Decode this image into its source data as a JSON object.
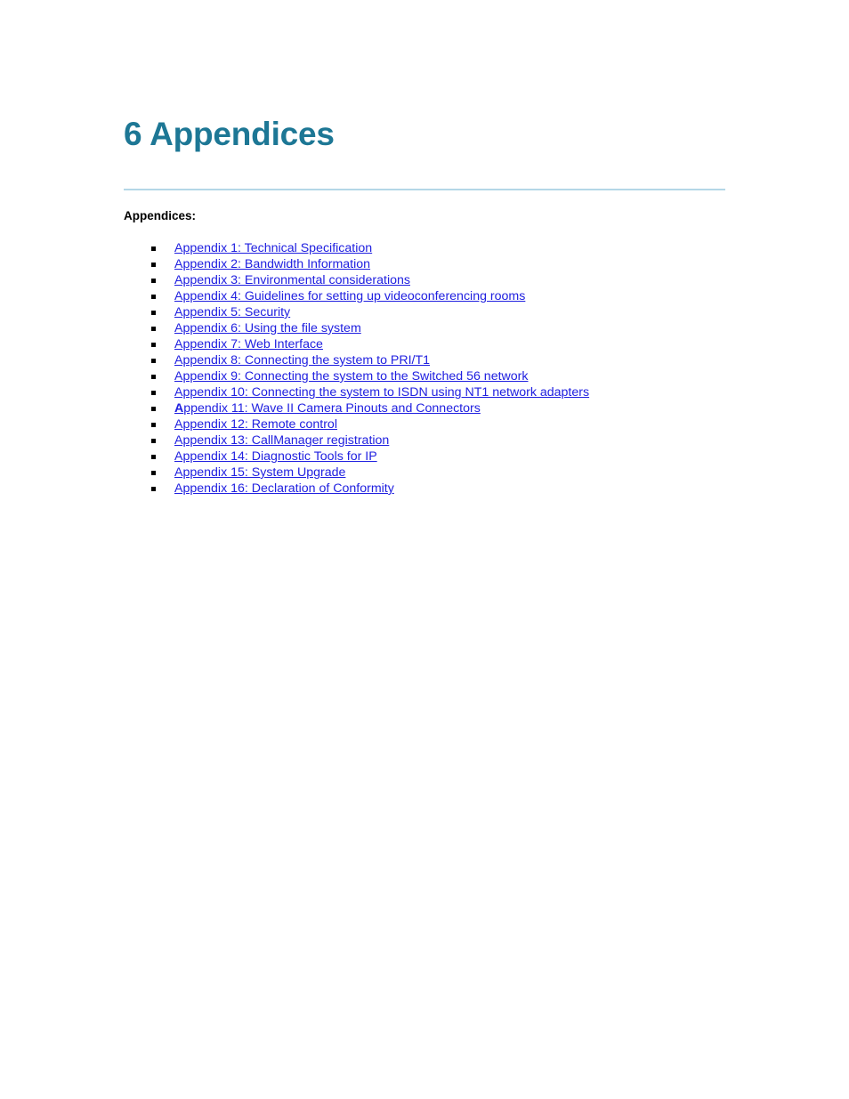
{
  "document": {
    "chapter_number": "6",
    "chapter_title": "6 Appendices",
    "section_label": "Appendices:",
    "colors": {
      "heading": "#1d7795",
      "rule": "#b4d7e7",
      "link": "#2020e0",
      "bullet": "#000000",
      "page_background": "#ffffff"
    }
  },
  "appendix_list": {
    "bullet_glyph": "square-bullet",
    "items": [
      {
        "label": "Appendix 1: Technical Specification",
        "bold_prefix": ""
      },
      {
        "label": "Appendix 2: Bandwidth Information",
        "bold_prefix": ""
      },
      {
        "label": "Appendix 3: Environmental considerations",
        "bold_prefix": ""
      },
      {
        "label": "Appendix 4: Guidelines for setting up videoconferencing rooms",
        "bold_prefix": ""
      },
      {
        "label": "Appendix 5: Security",
        "bold_prefix": ""
      },
      {
        "label": "Appendix 6: Using the file system",
        "bold_prefix": ""
      },
      {
        "label": "Appendix 7: Web Interface",
        "bold_prefix": ""
      },
      {
        "label": "Appendix 8: Connecting the system to PRI/T1",
        "bold_prefix": ""
      },
      {
        "label": "Appendix 9: Connecting the system to the Switched 56 network",
        "bold_prefix": ""
      },
      {
        "label": "Appendix 10: Connecting the system to ISDN using NT1 network adapters",
        "bold_prefix": ""
      },
      {
        "label": "ppendix 11: Wave II Camera Pinouts and Connectors",
        "bold_prefix": "A"
      },
      {
        "label": "Appendix 12: Remote control",
        "bold_prefix": ""
      },
      {
        "label": "Appendix 13: CallManager registration",
        "bold_prefix": ""
      },
      {
        "label": "Appendix 14: Diagnostic Tools for IP",
        "bold_prefix": ""
      },
      {
        "label": "Appendix 15: System Upgrade",
        "bold_prefix": ""
      },
      {
        "label": "Appendix 16: Declaration of Conformity",
        "bold_prefix": ""
      }
    ]
  }
}
